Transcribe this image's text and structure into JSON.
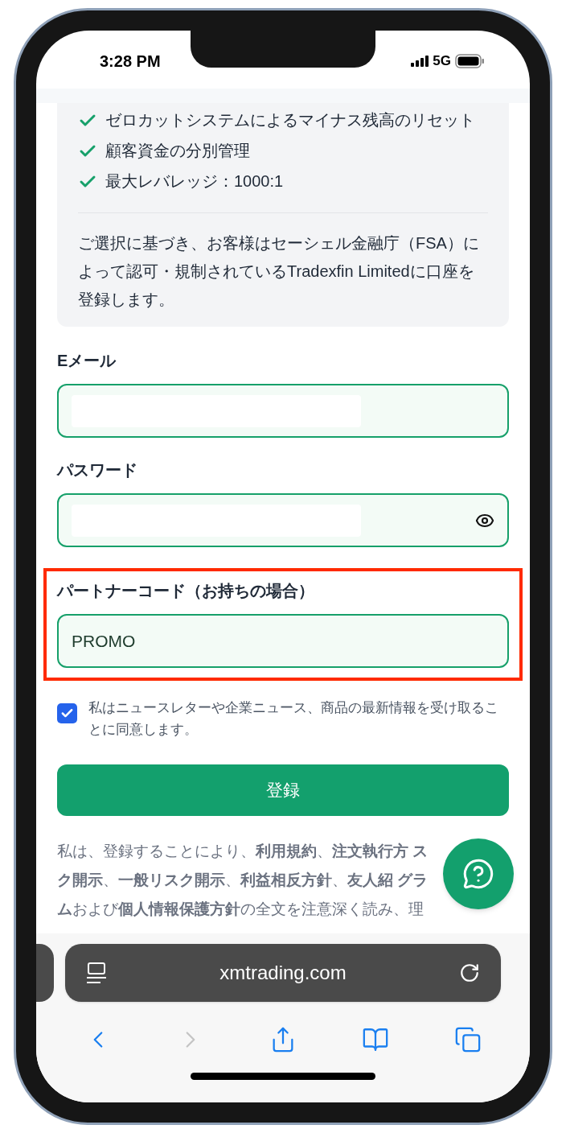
{
  "status_bar": {
    "time": "3:28 PM",
    "network": "5G"
  },
  "info_card": {
    "features": [
      "ゼロカットシステムによるマイナス残高のリセット",
      "顧客資金の分別管理",
      "最大レバレッジ：1000:1"
    ],
    "notice": "ご選択に基づき、お客様はセーシェル金融庁（FSA）によって認可・規制されているTradexfin Limitedに口座を登録します。"
  },
  "form": {
    "fields": [
      {
        "kind": "email",
        "label": "Eメール",
        "value_hidden": true,
        "highlighted": false
      },
      {
        "kind": "password",
        "label": "パスワード",
        "value_hidden": true,
        "highlighted": false
      },
      {
        "kind": "text",
        "label": "パートナーコード（お持ちの場合）",
        "value": "PROMO",
        "value_hidden": false,
        "highlighted": true
      }
    ],
    "newsletter": {
      "label": "私はニュースレターや企業ニュース、商品の最新情報を受け取ることに同意します。",
      "checked": true
    },
    "submit_button": "登録",
    "legal_text": "私は、登録することにより、**利用規約**、**注文執行方** **スク開示**、**一般リスク開示**、**利益相反方針**、**友人紹** **グラム**および**個人情報保護方針**の全文を注意深く読み、理"
  },
  "browser": {
    "url": "xmtrading.com",
    "toolbar": [
      {
        "kind": "back",
        "disabled": false
      },
      {
        "kind": "forward",
        "disabled": true
      },
      {
        "kind": "share",
        "disabled": false
      },
      {
        "kind": "bookmarks",
        "disabled": false
      },
      {
        "kind": "tabs",
        "disabled": false
      }
    ]
  }
}
